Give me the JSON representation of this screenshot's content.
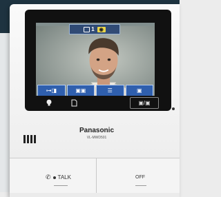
{
  "screen": {
    "channel": "1",
    "badge": "◉"
  },
  "softkeys": [
    {
      "label": "⊶◨",
      "icon": "key-unlock-icon"
    },
    {
      "label": "▣▣",
      "icon": "camera-switch-icon"
    },
    {
      "label": "☰",
      "icon": "menu-icon"
    },
    {
      "label": "▣",
      "icon": "photo-icon"
    }
  ],
  "hardware": {
    "bulb_icon": "light-bulb-icon",
    "doc_icon": "document-icon",
    "box_label": "▣/▣"
  },
  "brand": {
    "name": "Panasonic",
    "model": "VL-MWD501"
  },
  "buttons": {
    "talk_label": "TALK",
    "off_label": "OFF"
  }
}
